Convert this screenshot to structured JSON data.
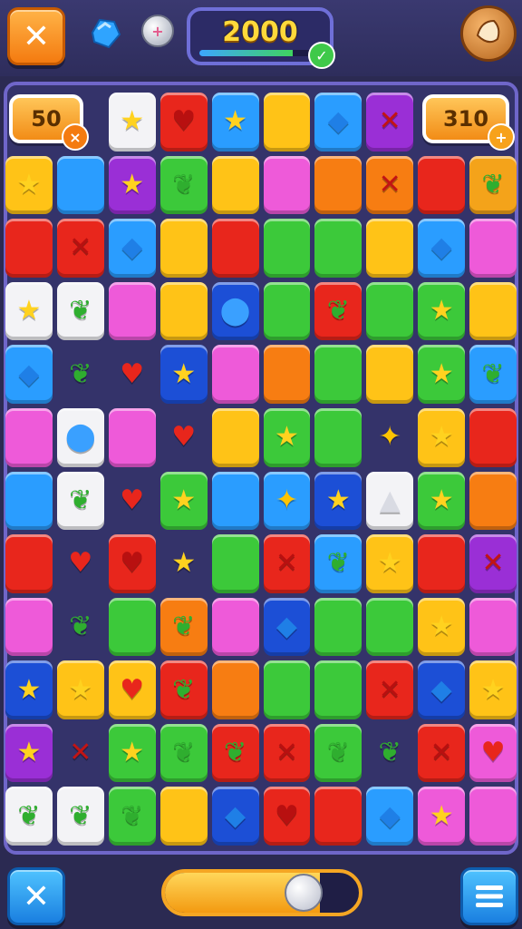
{
  "header": {
    "close_icon": "close-icon",
    "powerups": [
      "blue-gem-icon",
      "silver-orb-icon"
    ],
    "score": "2000",
    "score_progress": 0.82,
    "score_check_icon": "check-icon",
    "avatar_icon": "cookie-avatar-icon"
  },
  "board": {
    "left_counter": "50",
    "left_counter_badge": "×",
    "right_counter": "310",
    "right_counter_badge": "+",
    "colors": {
      "R": "#e8261c",
      "O": "#f77d12",
      "Y": "#ffc317",
      "G": "#3cc93a",
      "B": "#2a9dff",
      "D": "#1c4fd6",
      "P": "#ee5ad9",
      "V": "#9a2fd6",
      "W": "#f3f3f6",
      "N": "#f4a31a",
      "_": "transparent"
    },
    "glyph_symbols": {
      "star": "★",
      "heart": "♥",
      "diamond": "◆",
      "cross": "✕",
      "leaf": "❦",
      "drop": "⬤",
      "shard": "▲",
      "sparkle": "✦",
      "none": ""
    },
    "rows": [
      [
        [
          "_",
          "none"
        ],
        [
          "_",
          "none"
        ],
        [
          "W",
          "star"
        ],
        [
          "R",
          "heart"
        ],
        [
          "B",
          "star"
        ],
        [
          "Y",
          "none"
        ],
        [
          "B",
          "diamond"
        ],
        [
          "V",
          "cross"
        ],
        [
          "_",
          "none"
        ],
        [
          "_",
          "none"
        ]
      ],
      [
        [
          "Y",
          "star"
        ],
        [
          "B",
          "none"
        ],
        [
          "V",
          "star"
        ],
        [
          "G",
          "leaf"
        ],
        [
          "Y",
          "none"
        ],
        [
          "P",
          "none"
        ],
        [
          "O",
          "none"
        ],
        [
          "O",
          "cross"
        ],
        [
          "R",
          "none"
        ],
        [
          "N",
          "leaf"
        ]
      ],
      [
        [
          "R",
          "none"
        ],
        [
          "R",
          "cross"
        ],
        [
          "B",
          "diamond"
        ],
        [
          "Y",
          "none"
        ],
        [
          "R",
          "none"
        ],
        [
          "G",
          "none"
        ],
        [
          "G",
          "none"
        ],
        [
          "Y",
          "none"
        ],
        [
          "B",
          "diamond"
        ],
        [
          "P",
          "none"
        ]
      ],
      [
        [
          "W",
          "star"
        ],
        [
          "W",
          "leaf"
        ],
        [
          "P",
          "none"
        ],
        [
          "Y",
          "none"
        ],
        [
          "D",
          "drop"
        ],
        [
          "G",
          "none"
        ],
        [
          "R",
          "leaf"
        ],
        [
          "G",
          "none"
        ],
        [
          "G",
          "star"
        ],
        [
          "Y",
          "none"
        ]
      ],
      [
        [
          "B",
          "diamond"
        ],
        [
          "_",
          "leaf"
        ],
        [
          "_",
          "heart"
        ],
        [
          "D",
          "star"
        ],
        [
          "P",
          "none"
        ],
        [
          "O",
          "none"
        ],
        [
          "G",
          "none"
        ],
        [
          "Y",
          "none"
        ],
        [
          "G",
          "star"
        ],
        [
          "B",
          "leaf"
        ]
      ],
      [
        [
          "P",
          "none"
        ],
        [
          "W",
          "drop"
        ],
        [
          "P",
          "none"
        ],
        [
          "_",
          "heart"
        ],
        [
          "Y",
          "none"
        ],
        [
          "G",
          "star"
        ],
        [
          "G",
          "none"
        ],
        [
          "_",
          "sparkle"
        ],
        [
          "Y",
          "star"
        ],
        [
          "R",
          "none"
        ]
      ],
      [
        [
          "B",
          "none"
        ],
        [
          "W",
          "leaf"
        ],
        [
          "_",
          "heart"
        ],
        [
          "G",
          "star"
        ],
        [
          "B",
          "none"
        ],
        [
          "B",
          "sparkle"
        ],
        [
          "D",
          "star"
        ],
        [
          "W",
          "shard"
        ],
        [
          "G",
          "star"
        ],
        [
          "O",
          "none"
        ]
      ],
      [
        [
          "R",
          "none"
        ],
        [
          "_",
          "heart"
        ],
        [
          "R",
          "heart"
        ],
        [
          "_",
          "star"
        ],
        [
          "G",
          "none"
        ],
        [
          "R",
          "cross"
        ],
        [
          "B",
          "leaf"
        ],
        [
          "Y",
          "star"
        ],
        [
          "R",
          "none"
        ],
        [
          "V",
          "cross"
        ]
      ],
      [
        [
          "P",
          "none"
        ],
        [
          "_",
          "leaf"
        ],
        [
          "G",
          "none"
        ],
        [
          "O",
          "leaf"
        ],
        [
          "P",
          "none"
        ],
        [
          "D",
          "diamond"
        ],
        [
          "G",
          "none"
        ],
        [
          "G",
          "none"
        ],
        [
          "Y",
          "star"
        ],
        [
          "P",
          "none"
        ]
      ],
      [
        [
          "D",
          "star"
        ],
        [
          "Y",
          "star"
        ],
        [
          "Y",
          "heart"
        ],
        [
          "R",
          "leaf"
        ],
        [
          "O",
          "none"
        ],
        [
          "G",
          "none"
        ],
        [
          "G",
          "none"
        ],
        [
          "R",
          "cross"
        ],
        [
          "D",
          "diamond"
        ],
        [
          "Y",
          "star"
        ]
      ],
      [
        [
          "V",
          "star"
        ],
        [
          "_",
          "cross"
        ],
        [
          "G",
          "star"
        ],
        [
          "G",
          "leaf"
        ],
        [
          "R",
          "leaf"
        ],
        [
          "R",
          "cross"
        ],
        [
          "G",
          "leaf"
        ],
        [
          "_",
          "leaf"
        ],
        [
          "R",
          "cross"
        ],
        [
          "P",
          "heart"
        ]
      ],
      [
        [
          "W",
          "leaf"
        ],
        [
          "W",
          "leaf"
        ],
        [
          "G",
          "leaf"
        ],
        [
          "Y",
          "none"
        ],
        [
          "D",
          "diamond"
        ],
        [
          "R",
          "heart"
        ],
        [
          "R",
          "none"
        ],
        [
          "B",
          "diamond"
        ],
        [
          "P",
          "star"
        ],
        [
          "P",
          "none"
        ]
      ]
    ]
  },
  "footer": {
    "close_icon": "close-icon",
    "menu_icon": "menu-icon",
    "slider_level": 0.8
  }
}
